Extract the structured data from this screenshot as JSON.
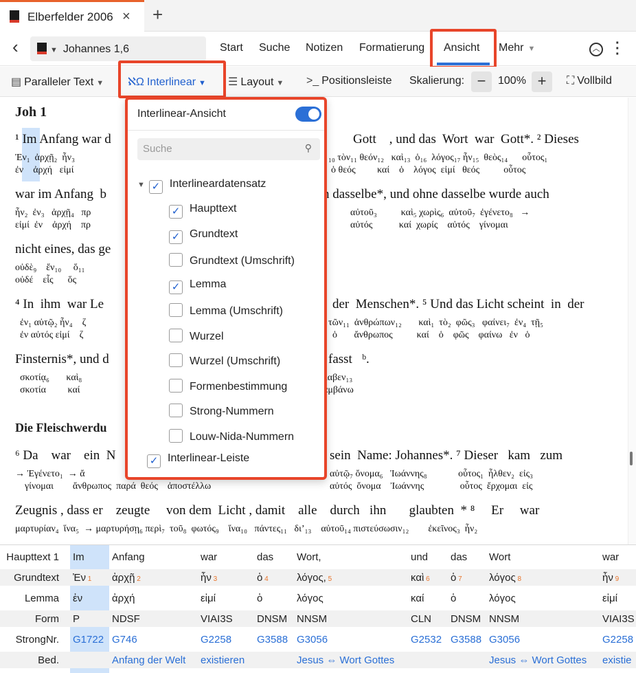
{
  "tab": {
    "title": "Elberfelder 2006",
    "close": "×",
    "new": "+"
  },
  "nav": {
    "back": "‹",
    "reference": "Johannes 1,6",
    "items": [
      "Start",
      "Suche",
      "Notizen",
      "Formatierung",
      "Ansicht",
      "Mehr"
    ],
    "active": "Ansicht"
  },
  "toolbar": {
    "parallel": "Paralleler Text",
    "interlinear": "Interlinear",
    "layout": "Layout",
    "position": "Positionsleiste",
    "scale_label": "Skalierung:",
    "zoom_out": "−",
    "zoom": "100%",
    "zoom_in": "+",
    "fullscreen": "Vollbild"
  },
  "content": {
    "chapter": "Joh 1",
    "lines": [
      "¹ Im Anfang war d",
      "war im Anfang  b",
      "nicht eines, das ge",
      "⁴ In  ihm  war Le",
      "Finsternis*, und d",
      "⁶ Da    war    ein  N",
      "Zeugnis , dass er    zeugte     von dem  Licht , damit    alle    durch   ihn       glaubten  * ⁸     Er     war"
    ],
    "right_lines": [
      "Gott    , und das  Wort  war  Gott*. ² Dieses",
      "n dasselbe*, und ohne dasselbe wurde auch",
      "der  Menschen*. ⁵ Und das Licht scheint  in  der",
      "fasst   ᵇ.",
      "sein  Name: Johannes*. ⁷ Dieser   kam   zum"
    ],
    "section_heading": "Die Fleischwerdu"
  },
  "dropdown": {
    "title": "Interlinear-Ansicht",
    "search_placeholder": "Suche",
    "group": "Interlineardatensatz",
    "options": [
      {
        "label": "Haupttext",
        "checked": true
      },
      {
        "label": "Grundtext",
        "checked": true
      },
      {
        "label": "Grundtext (Umschrift)",
        "checked": false
      },
      {
        "label": "Lemma",
        "checked": true
      },
      {
        "label": "Lemma (Umschrift)",
        "checked": false
      },
      {
        "label": "Wurzel",
        "checked": false
      },
      {
        "label": "Wurzel (Umschrift)",
        "checked": false
      },
      {
        "label": "Formenbestimmung",
        "checked": false
      },
      {
        "label": "Strong-Nummern",
        "checked": false
      },
      {
        "label": "Louw-Nida-Nummern",
        "checked": false
      }
    ],
    "footer": "Interlinear-Leiste"
  },
  "ibar": {
    "labels": [
      "Haupttext 1",
      "Grundtext",
      "Lemma",
      "Form",
      "StrongNr.",
      "Bed."
    ],
    "haupttext": [
      "Im",
      "Anfang",
      "war",
      "das",
      "Wort,",
      "und",
      "das",
      "Wort",
      "war"
    ],
    "grundtext": [
      "Ἐν",
      "ἀρχῇ",
      "ἦν",
      "ὁ",
      "λόγος,",
      "καὶ",
      "ὁ",
      "λόγος",
      "ἦν"
    ],
    "grundnum": [
      "1",
      "2",
      "3",
      "4",
      "5",
      "6",
      "7",
      "8",
      "9"
    ],
    "lemma": [
      "ἐν",
      "ἀρχή",
      "εἰμί",
      "ὁ",
      "λόγος",
      "καί",
      "ὁ",
      "λόγος",
      "εἰμί"
    ],
    "form": [
      "P",
      "NDSF",
      "VIAI3S",
      "DNSM",
      "NNSM",
      "CLN",
      "DNSM",
      "NNSM",
      "VIAI3S"
    ],
    "strong": [
      "G1722",
      "G746",
      "G2258",
      "G3588",
      "G3056",
      "G2532",
      "G3588",
      "G3056",
      "G2258"
    ],
    "bed": [
      "",
      "Anfang der Welt",
      "existieren",
      "",
      "Jesus ⇔ Wort Gottes",
      "",
      "",
      "Jesus ⇔ Wort Gottes",
      "existie"
    ]
  }
}
